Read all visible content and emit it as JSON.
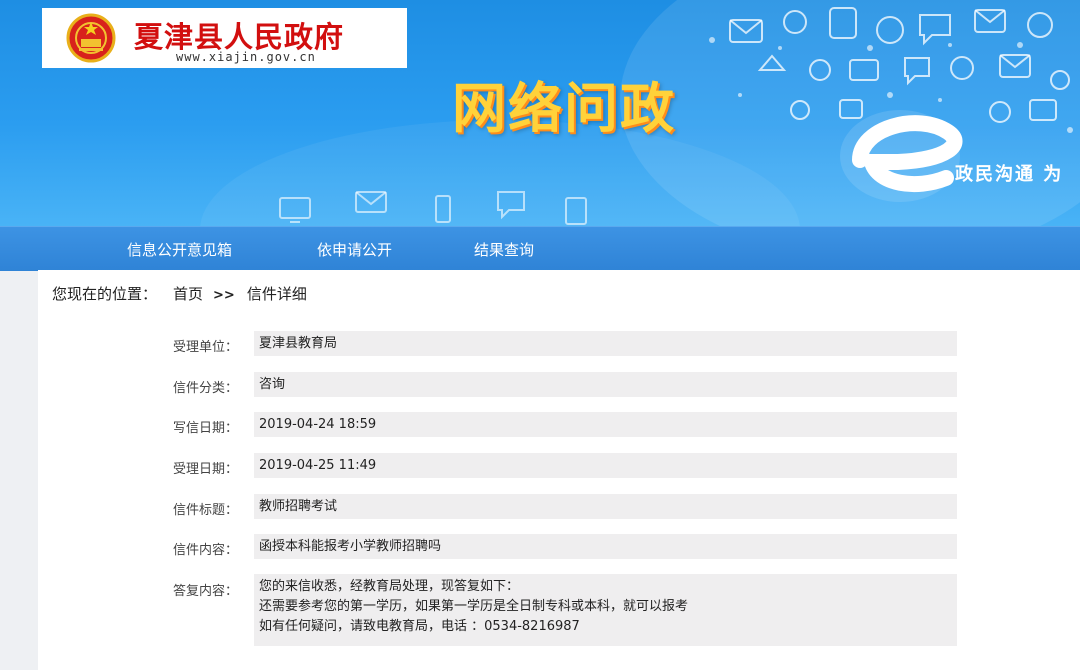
{
  "header": {
    "site_name": "夏津县人民政府",
    "site_url": "www.xiajin.gov.cn",
    "brand_title": "网络问政",
    "slogan": "政民沟通  为"
  },
  "nav": {
    "items": [
      "信息公开意见箱",
      "依申请公开",
      "结果查询"
    ]
  },
  "breadcrumb": {
    "label": "您现在的位置：",
    "home": "首页",
    "separator": ">>",
    "current": "信件详细"
  },
  "letter": {
    "fields": [
      {
        "label": "受理单位：",
        "value": "夏津县教育局"
      },
      {
        "label": "信件分类：",
        "value": "咨询"
      },
      {
        "label": "写信日期：",
        "value": "2019-04-24 18:59"
      },
      {
        "label": "受理日期：",
        "value": "2019-04-25 11:49"
      },
      {
        "label": "信件标题：",
        "value": "教师招聘考试"
      },
      {
        "label": "信件内容：",
        "value": "函授本科能报考小学教师招聘吗"
      }
    ],
    "reply": {
      "label": "答复内容：",
      "lines": [
        "您的来信收悉，经教育局处理，现答复如下：",
        "还需要参考您的第一学历，如果第一学历是全日制专科或本科，就可以报考",
        "如有任何疑问，请致电教育局，电话 ：0534-8216987"
      ]
    }
  },
  "icons": {
    "emblem": "national-emblem-icon",
    "e_logo": "e-government-logo-icon"
  },
  "colors": {
    "banner_blue": "#2b9df0",
    "nav_blue": "#2f83d6",
    "title_red": "#d20f0f",
    "brand_yellow": "#ffd23a",
    "field_bg": "#efeeef"
  }
}
